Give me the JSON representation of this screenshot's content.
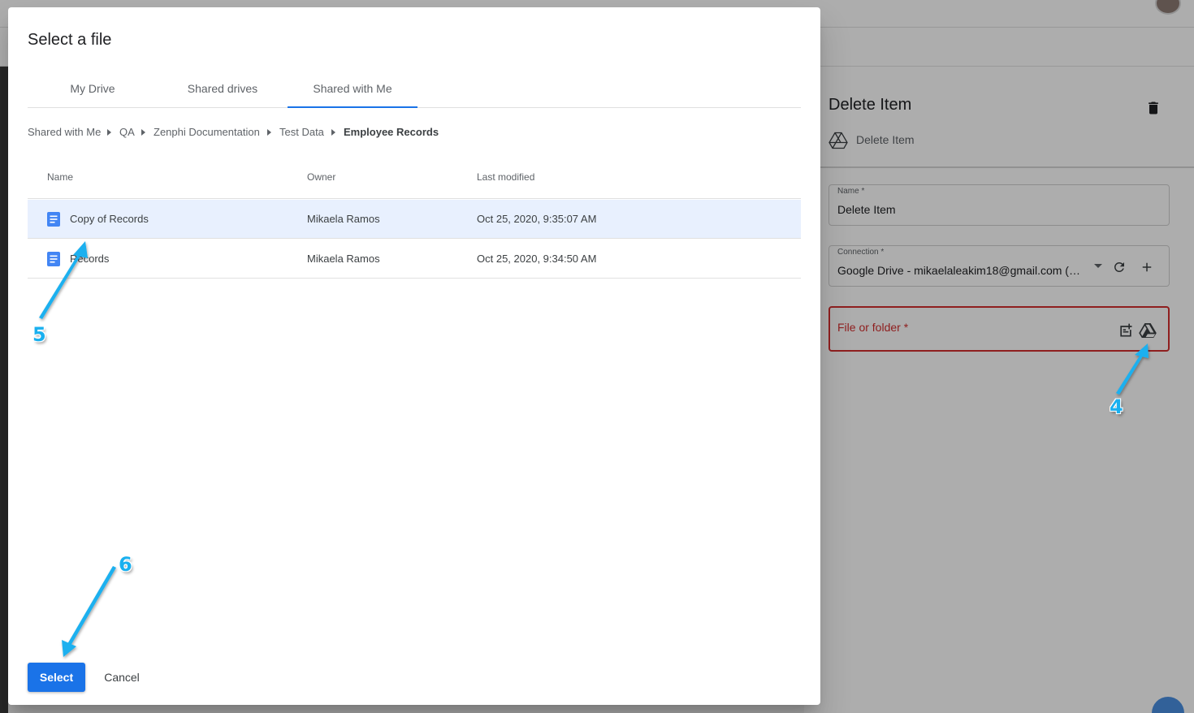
{
  "background_panel": {
    "title": "Delete Item",
    "subtitle": "Delete Item",
    "name_field": {
      "label": "Name *",
      "value": "Delete Item"
    },
    "connection_field": {
      "label": "Connection *",
      "value": "Google Drive - mikaelaleakim18@gmail.com (mi..."
    },
    "file_field": {
      "label": "File or folder *"
    },
    "icons": [
      "trash-icon",
      "google-drive-outline-icon",
      "dropdown-caret-icon",
      "refresh-icon",
      "plus-icon",
      "note-add-icon",
      "google-drive-icon"
    ]
  },
  "dialog": {
    "title": "Select a file",
    "tabs": [
      {
        "label": "My Drive"
      },
      {
        "label": "Shared drives"
      },
      {
        "label": "Shared with Me",
        "active": true
      }
    ],
    "breadcrumb": [
      "Shared with Me",
      "QA",
      "Zenphi Documentation",
      "Test Data",
      "Employee Records"
    ],
    "table": {
      "columns": [
        "Name",
        "Owner",
        "Last modified"
      ],
      "rows": [
        {
          "name": "Copy of Records",
          "owner": "Mikaela Ramos",
          "modified": "Oct 25, 2020, 9:35:07 AM",
          "selected": true
        },
        {
          "name": "Records",
          "owner": "Mikaela Ramos",
          "modified": "Oct 25, 2020, 9:34:50 AM",
          "selected": false
        }
      ]
    },
    "buttons": {
      "select": "Select",
      "cancel": "Cancel"
    }
  },
  "annotations": [
    {
      "number": "4"
    },
    {
      "number": "5"
    },
    {
      "number": "6"
    }
  ],
  "colors": {
    "accent": "#1a73e8",
    "selected_row": "#e8f0fe",
    "error": "#d32f2f",
    "callout": "#1ab0ef",
    "doc_icon": "#4285f4"
  }
}
